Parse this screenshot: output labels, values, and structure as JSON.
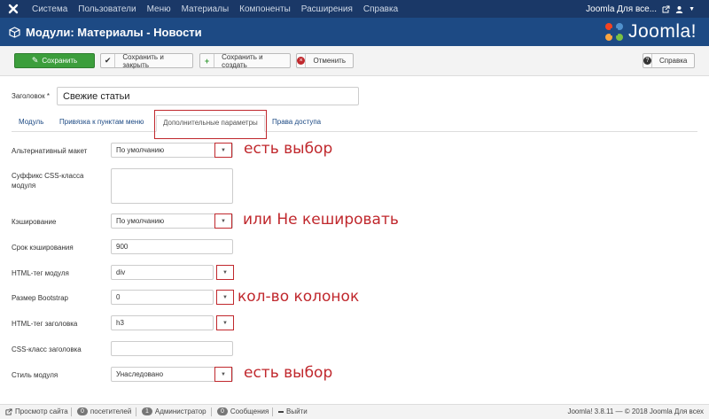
{
  "topbar": {
    "menu": [
      "Система",
      "Пользователи",
      "Меню",
      "Материалы",
      "Компоненты",
      "Расширения",
      "Справка"
    ],
    "site_name": "Joomla Для все...",
    "caret": "▼"
  },
  "header": {
    "title": "Модули: Материалы - Новости",
    "brand": "Joomla!"
  },
  "toolbar": {
    "save": "Сохранить",
    "save_close": "Сохранить и закрыть",
    "save_new": "Сохранить и создать",
    "cancel": "Отменить",
    "help": "Справка"
  },
  "form": {
    "title_label": "Заголовок *",
    "title_value": "Свежие статьи",
    "tabs": [
      "Модуль",
      "Привязка к пунктам меню",
      "Дополнительные параметры",
      "Права доступа"
    ],
    "fields": {
      "layout_label": "Альтернативный макет",
      "layout_value": "По умолчанию",
      "css_suffix_label": "Суффикс CSS-класса модуля",
      "caching_label": "Кэширование",
      "caching_value": "По умолчанию",
      "cache_time_label": "Срок кэширования",
      "cache_time_value": "900",
      "html_tag_label": "HTML-тег модуля",
      "html_tag_value": "div",
      "bootstrap_label": "Размер Bootstrap",
      "bootstrap_value": "0",
      "header_tag_label": "HTML-тег заголовка",
      "header_tag_value": "h3",
      "header_class_label": "CSS-класс заголовка",
      "style_label": "Стиль модуля",
      "style_value": "Унаследовано"
    }
  },
  "annotations": {
    "a1": "есть выбор",
    "a2": "или Не кешировать",
    "a3": "кол-во колонок",
    "a4": "есть выбор"
  },
  "statusbar": {
    "preview": "Просмотр сайта",
    "visitors_count": "0",
    "visitors": "посетителей",
    "admins_count": "1",
    "admins": "Администратор",
    "messages_count": "0",
    "messages": "Сообщения",
    "logout": "Выйти",
    "version": "Joomla! 3.8.11  —  © 2018 Joomla Для всех"
  },
  "colors": {
    "nav": "#1a3867",
    "header": "#1d4a84",
    "save": "#3c9e3c",
    "annotation": "#c0282d"
  }
}
